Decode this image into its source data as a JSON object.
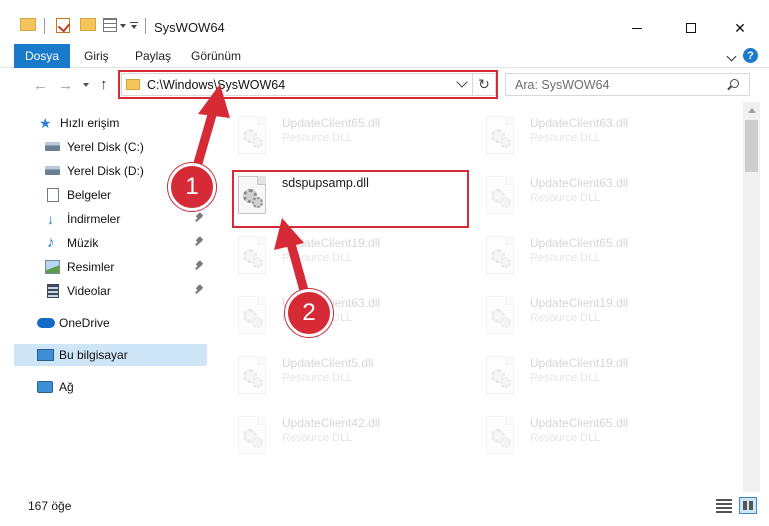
{
  "window": {
    "title": "SysWOW64",
    "minimize_glyph": "",
    "close_glyph": "✕"
  },
  "ribbon": {
    "tabs": [
      {
        "label": "Dosya"
      },
      {
        "label": "Giriş"
      },
      {
        "label": "Paylaş"
      },
      {
        "label": "Görünüm"
      }
    ],
    "help_glyph": "?"
  },
  "nav": {
    "back_glyph": "←",
    "forward_glyph": "→",
    "up_glyph": "↑",
    "refresh_glyph": "↻",
    "address": "C:\\Windows\\SysWOW64",
    "search_placeholder": "Ara: SysWOW64"
  },
  "sidebar": {
    "items": [
      {
        "label": "Hızlı erişim",
        "icon": "star-icon"
      },
      {
        "label": "Yerel Disk (C:)",
        "icon": "drive-icon"
      },
      {
        "label": "Yerel Disk (D:)",
        "icon": "drive-icon"
      },
      {
        "label": "Belgeler",
        "icon": "document-icon"
      },
      {
        "label": "İndirmeler",
        "icon": "download-icon"
      },
      {
        "label": "Müzik",
        "icon": "music-icon"
      },
      {
        "label": "Resimler",
        "icon": "pictures-icon"
      },
      {
        "label": "Videolar",
        "icon": "video-icon"
      },
      {
        "label": "OneDrive",
        "icon": "cloud-icon"
      },
      {
        "label": "Bu bilgisayar",
        "icon": "computer-icon",
        "selected": true
      },
      {
        "label": "Ağ",
        "icon": "network-icon"
      }
    ],
    "star_glyph": "★",
    "down_glyph": "↓",
    "music_glyph": "♪"
  },
  "files": {
    "target": {
      "name": "sdspupsamp.dll"
    },
    "background": [
      {
        "name": "UpdateClient65.dll",
        "type": "Resource DLL"
      },
      {
        "name": "UpdateClient63.dll",
        "type": "Resource DLL"
      },
      {
        "name": "UpdateClient63.dll",
        "type": "Resource DLL"
      },
      {
        "name": "UpdateClient19.dll",
        "type": "Resource DLL"
      },
      {
        "name": "UpdateClient65.dll",
        "type": "Resource DLL"
      },
      {
        "name": "UpdateClient63.dll",
        "type": "Resource DLL"
      },
      {
        "name": "UpdateClient19.dll",
        "type": "Resource DLL"
      },
      {
        "name": "UpdateClient5.dll",
        "type": "Resource DLL"
      },
      {
        "name": "UpdateClient19.dll",
        "type": "Resource DLL"
      },
      {
        "name": "UpdateClient42.dll",
        "type": "Resource DLL"
      },
      {
        "name": "UpdateClient65.dll",
        "type": "Resource DLL"
      }
    ]
  },
  "status": {
    "count": "167 öğe"
  },
  "annotations": {
    "step1": "1",
    "step2": "2",
    "color": "#d62b36"
  },
  "colors": {
    "accent": "#1979ca",
    "selection": "#cde5f7"
  }
}
